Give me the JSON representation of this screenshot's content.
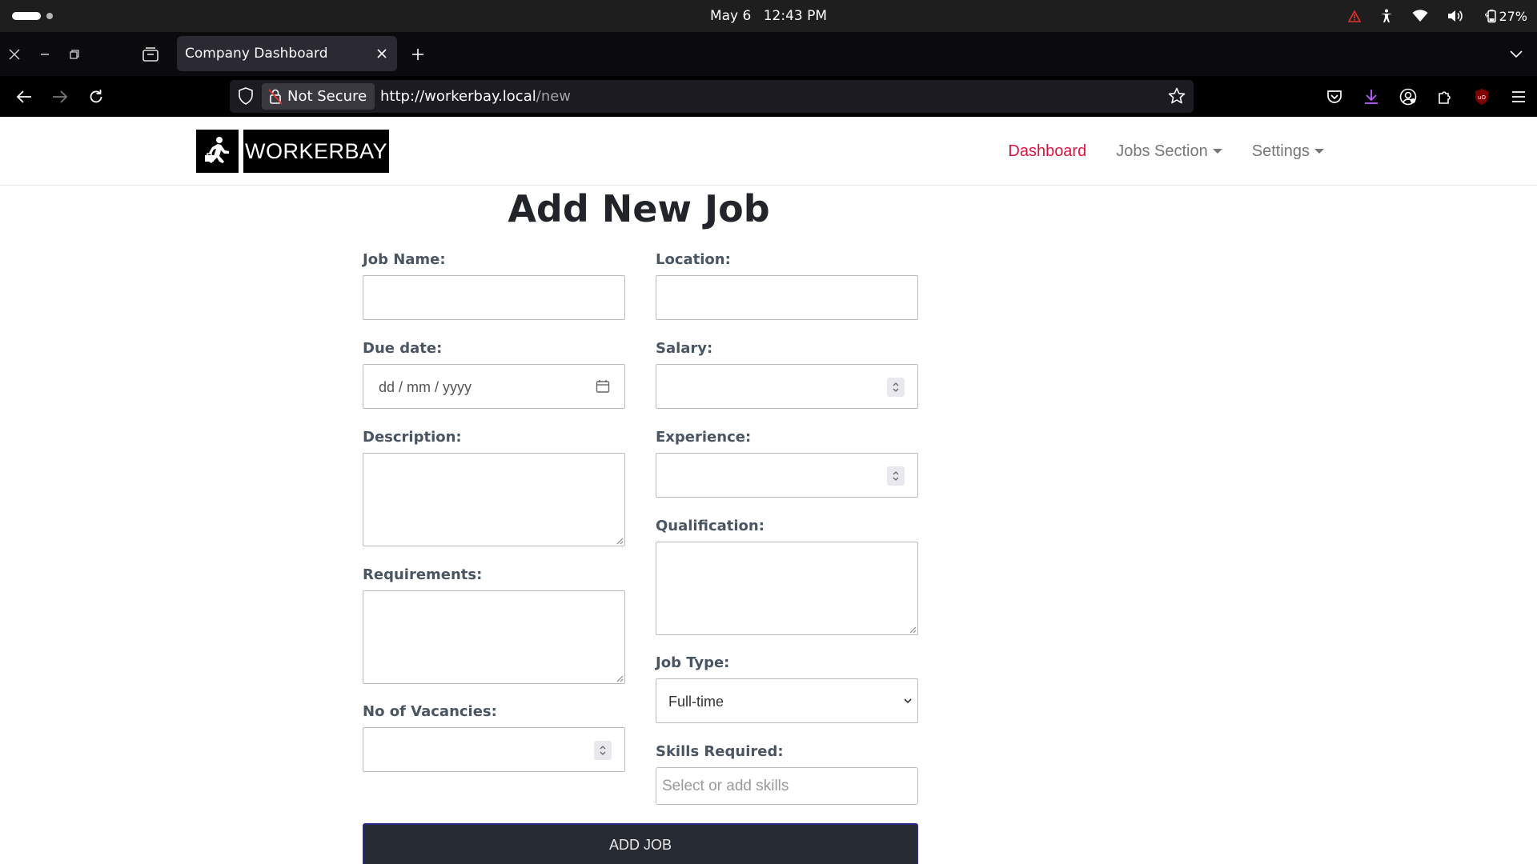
{
  "os": {
    "date": "May 6",
    "time": "12:43 PM",
    "battery": "27%"
  },
  "browser": {
    "tab_title": "Company Dashboard",
    "not_secure_label": "Not Secure",
    "url_host": "http://workerbay.local",
    "url_path": "/new"
  },
  "site": {
    "logo_text": "WORKERBAY",
    "nav": {
      "dashboard": "Dashboard",
      "jobs_section": "Jobs Section",
      "settings": "Settings"
    },
    "active_color": "#dc143c"
  },
  "form": {
    "title": "Add New Job",
    "job_name_label": "Job Name:",
    "location_label": "Location:",
    "due_date_label": "Due date:",
    "due_date_placeholder": "dd / mm / yyyy",
    "salary_label": "Salary:",
    "description_label": "Description:",
    "experience_label": "Experience:",
    "qualification_label": "Qualification:",
    "requirements_label": "Requirements:",
    "job_type_label": "Job Type:",
    "job_type_value": "Full-time",
    "vacancies_label": "No of Vacancies:",
    "skills_label": "Skills Required:",
    "skills_placeholder": "Select or add skills",
    "submit_label": "ADD JOB"
  }
}
